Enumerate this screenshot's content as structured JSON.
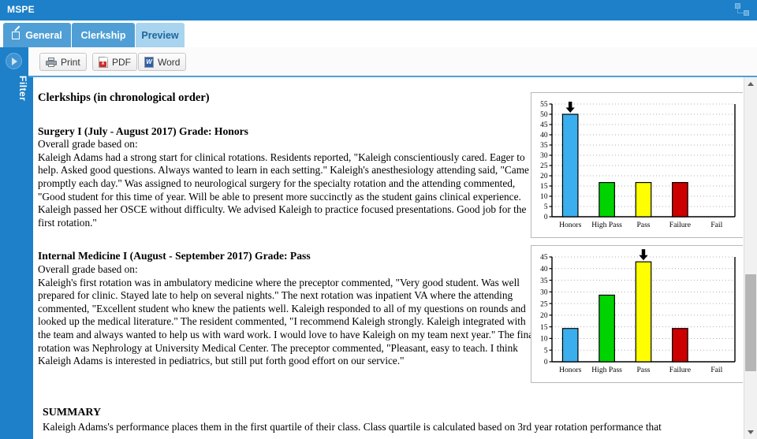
{
  "window": {
    "title": "MSPE",
    "resize_icon": "resize-handle-icon"
  },
  "tabs": [
    {
      "label": "General",
      "icon": "edit-pencil-icon",
      "active": false
    },
    {
      "label": "Clerkship",
      "icon": "",
      "active": false
    },
    {
      "label": "Preview",
      "icon": "",
      "active": true
    }
  ],
  "sidebar": {
    "label": "Filter",
    "expand_icon": "chevron-right-circle-icon"
  },
  "toolbar": {
    "print_label": "Print",
    "pdf_label": "PDF",
    "word_label": "Word",
    "print_icon": "printer-icon",
    "pdf_icon": "pdf-file-icon",
    "word_icon": "word-file-icon",
    "pdf_badge": "A"
  },
  "document": {
    "heading": "Clerkships (in chronological order)",
    "sections": [
      {
        "title": "Surgery I (July - August 2017) Grade: Honors",
        "subtitle": "Overall grade based on:",
        "body": "Kaleigh Adams had a strong start for clinical rotations. Residents reported, \"Kaleigh conscientiously cared. Eager to help. Asked good questions. Always wanted to learn in each setting.\" Kaleigh's anesthesiology attending said, \"Came promptly each day.\" Was assigned to neurological surgery for the specialty rotation and the attending commented, \"Good student for this time of year. Will be able to present more succinctly as the student gains clinical experience. Kaleigh passed her OSCE without difficulty. We advised Kaleigh to practice focused presentations. Good job for the first rotation.\""
      },
      {
        "title": "Internal Medicine I (August - September 2017) Grade: Pass",
        "subtitle": "Overall grade based on:",
        "body": "Kaleigh's first rotation was in ambulatory medicine where the preceptor commented, \"Very good student. Was well prepared for clinic. Stayed late to help on several nights.\" The next rotation was inpatient VA where the attending commented, \"Excellent student who knew the patients well. Kaleigh responded to all of my questions on rounds and looked up the medical literature.\" The resident commented, \"I recommend Kaleigh strongly. Kaleigh integrated with the team and always wanted to help us with ward work. I would love to have Kaleigh on my team next year.\" The final rotation was Nephrology at University Medical Center. The preceptor commented, \"Pleasant, easy to teach. I think Kaleigh Adams is interested in pediatrics, but still put forth good effort on our service.\""
      }
    ],
    "summary": {
      "title": "SUMMARY",
      "body": "Kaleigh Adams's performance places them in the first quartile of their class. Class quartile is calculated based on 3rd year rotation performance that"
    }
  },
  "chart_data": [
    {
      "type": "bar",
      "title": "",
      "categories": [
        "Honors",
        "High Pass",
        "Pass",
        "Failure",
        "Fail"
      ],
      "values": [
        50,
        16.7,
        16.7,
        16.7,
        0
      ],
      "colors": [
        "#3BAFEE",
        "#00D400",
        "#FFFF00",
        "#CC0000",
        "#CCCCCC"
      ],
      "ylim": [
        0,
        55
      ],
      "yticks": [
        0,
        5,
        10,
        15,
        20,
        25,
        30,
        35,
        40,
        45,
        50,
        55
      ],
      "xlabel": "",
      "ylabel": "",
      "grid": true,
      "marker": {
        "category": "Honors",
        "icon": "down-arrow-marker"
      }
    },
    {
      "type": "bar",
      "title": "",
      "categories": [
        "Honors",
        "High Pass",
        "Pass",
        "Failure",
        "Fail"
      ],
      "values": [
        14.3,
        28.6,
        42.9,
        14.3,
        0
      ],
      "colors": [
        "#3BAFEE",
        "#00D400",
        "#FFFF00",
        "#CC0000",
        "#CCCCCC"
      ],
      "ylim": [
        0,
        45
      ],
      "yticks": [
        0,
        5,
        10,
        15,
        20,
        25,
        30,
        35,
        40,
        45
      ],
      "xlabel": "",
      "ylabel": "",
      "grid": true,
      "marker": {
        "category": "Pass",
        "icon": "down-arrow-marker"
      }
    }
  ],
  "scrollbar": {
    "up_icon": "triangle-up-icon",
    "down_icon": "triangle-down-icon"
  }
}
